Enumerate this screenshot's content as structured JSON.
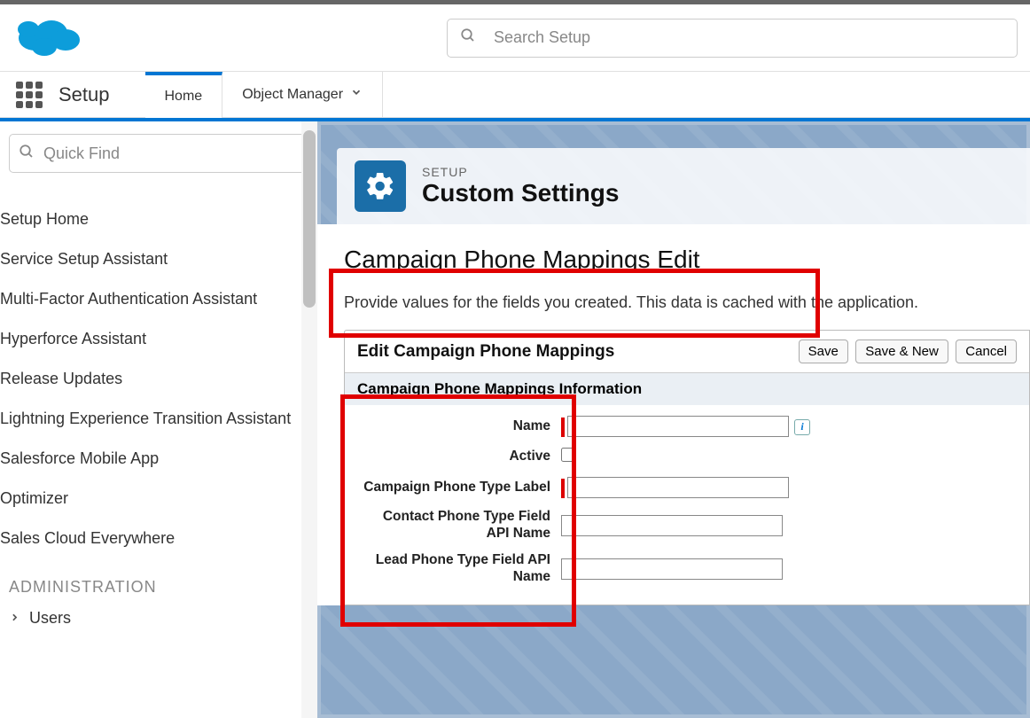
{
  "header": {
    "search_placeholder": "Search Setup"
  },
  "nav": {
    "app_title": "Setup",
    "tabs": [
      {
        "label": "Home"
      },
      {
        "label": "Object Manager"
      }
    ]
  },
  "sidebar": {
    "quickfind_placeholder": "Quick Find",
    "items": [
      "Setup Home",
      "Service Setup Assistant",
      "Multi-Factor Authentication Assistant",
      "Hyperforce Assistant",
      "Release Updates",
      "Lightning Experience Transition Assistant",
      "Salesforce Mobile App",
      "Optimizer",
      "Sales Cloud Everywhere"
    ],
    "section": "ADMINISTRATION",
    "sub": "Users"
  },
  "content": {
    "eyebrow": "SETUP",
    "title": "Custom Settings",
    "page_title": "Campaign Phone Mappings Edit",
    "description": "Provide values for the fields you created. This data is cached with the application.",
    "form_title": "Edit Campaign Phone Mappings",
    "buttons": {
      "save": "Save",
      "save_new": "Save & New",
      "cancel": "Cancel"
    },
    "section_title": "Campaign Phone Mappings Information",
    "fields": {
      "name": {
        "label": "Name",
        "value": ""
      },
      "active": {
        "label": "Active",
        "value": false
      },
      "phone_type_label": {
        "label": "Campaign Phone Type Label",
        "value": ""
      },
      "contact_api": {
        "label": "Contact Phone Type Field API Name",
        "value": ""
      },
      "lead_api": {
        "label": "Lead Phone Type Field API Name",
        "value": ""
      }
    }
  }
}
